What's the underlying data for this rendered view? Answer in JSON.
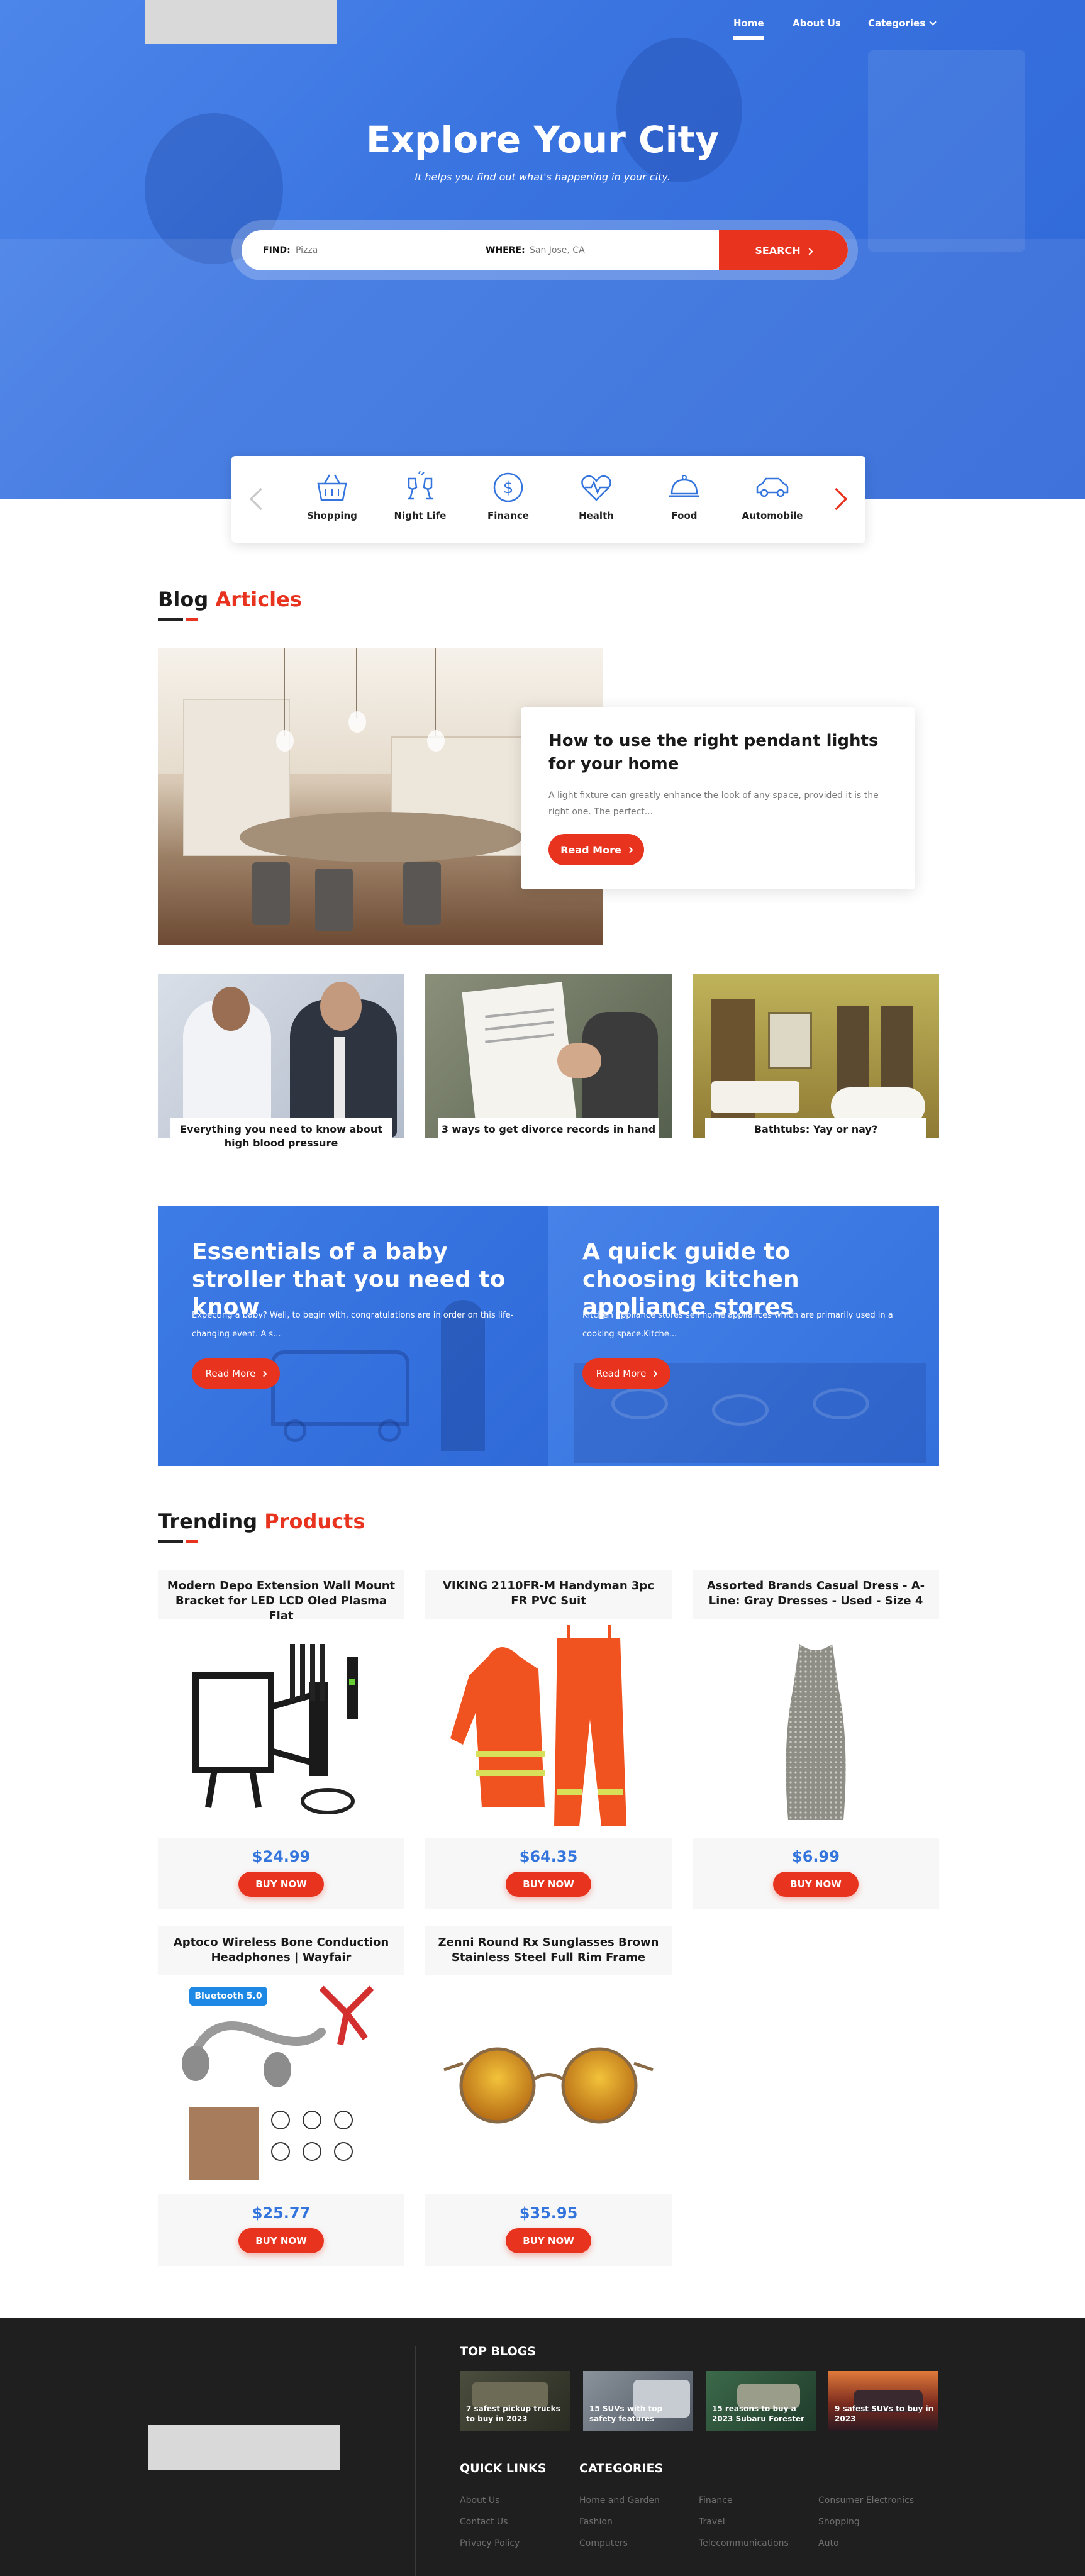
{
  "nav": {
    "home": "Home",
    "about": "About Us",
    "categories": "Categories"
  },
  "hero": {
    "title": "Explore Your City",
    "subtitle": "It helps you find out what's happening in your city."
  },
  "search": {
    "find_label": "FIND:",
    "find_placeholder": "Pizza",
    "where_label": "WHERE:",
    "where_placeholder": "San Jose, CA",
    "button": "SEARCH"
  },
  "categories": [
    {
      "label": "Shopping",
      "icon": "shopping-basket-icon"
    },
    {
      "label": "Night Life",
      "icon": "cheers-glasses-icon"
    },
    {
      "label": "Finance",
      "icon": "dollar-coin-icon"
    },
    {
      "label": "Health",
      "icon": "heart-pulse-icon"
    },
    {
      "label": "Food",
      "icon": "food-cloche-icon"
    },
    {
      "label": "Automobile",
      "icon": "car-icon"
    }
  ],
  "blog": {
    "heading_main": "Blog",
    "heading_accent": "Articles",
    "featured": {
      "title": "How to use the right pendant lights for your home",
      "excerpt": "A light fixture can greatly enhance the look of any space, provided it is the right one. The perfect...",
      "button": "Read More"
    },
    "cards": [
      {
        "title": "Everything you need to know about high blood pressure"
      },
      {
        "title": "3 ways to get divorce records in hand"
      },
      {
        "title": "Bathtubs: Yay or nay?"
      }
    ]
  },
  "promos": [
    {
      "title": "Essentials of a baby stroller that you need to know",
      "excerpt": "Expecting a baby? Well, to begin with, congratulations are in order on this life-changing event. A s...",
      "button": "Read More"
    },
    {
      "title": "A quick guide to choosing kitchen appliance stores",
      "excerpt": "Kitchen appliance stores sell home appliances which are primarily used in a cooking space.Kitche...",
      "button": "Read More"
    }
  ],
  "products": {
    "heading_main": "Trending",
    "heading_accent": "Products",
    "items": [
      {
        "title": "Modern Depo Extension Wall Mount Bracket for LED LCD Oled Plasma Flat",
        "price": "$24.99",
        "button": "BUY NOW"
      },
      {
        "title": "VIKING 2110FR-M Handyman 3pc FR PVC Suit",
        "price": "$64.35",
        "button": "BUY NOW"
      },
      {
        "title": "Assorted Brands Casual Dress - A-Line: Gray Dresses - Used - Size 4",
        "price": "$6.99",
        "button": "BUY NOW"
      },
      {
        "title": "Aptoco Wireless Bone Conduction Headphones | Wayfair",
        "price": "$25.77",
        "button": "BUY NOW",
        "badge": "Bluetooth 5.0"
      },
      {
        "title": "Zenni Round Rx Sunglasses Brown Stainless Steel Full Rim Frame",
        "price": "$35.95",
        "button": "BUY NOW"
      }
    ]
  },
  "footer": {
    "top_blogs_heading": "TOP BLOGS",
    "top_blogs": [
      "7 safest pickup trucks to buy in 2023",
      "15 SUVs with top safety features",
      "15 reasons to buy a 2023 Subaru Forester",
      "9 safest SUVs to buy in 2023"
    ],
    "quick_links_heading": "QUICK LINKS",
    "quick_links": [
      "About Us",
      "Contact Us",
      "Privacy Policy"
    ],
    "categories_heading": "CATEGORIES",
    "categories": [
      "Home and Garden",
      "Finance",
      "Consumer Electronics",
      "Fashion",
      "Travel",
      "Shopping",
      "Computers",
      "Telecommunications",
      "Auto"
    ]
  },
  "colors": {
    "hero_blue": "#3a74e0",
    "accent_red": "#e8331f",
    "price_blue": "#3475dd",
    "footer_bg": "#1f1f1f"
  }
}
